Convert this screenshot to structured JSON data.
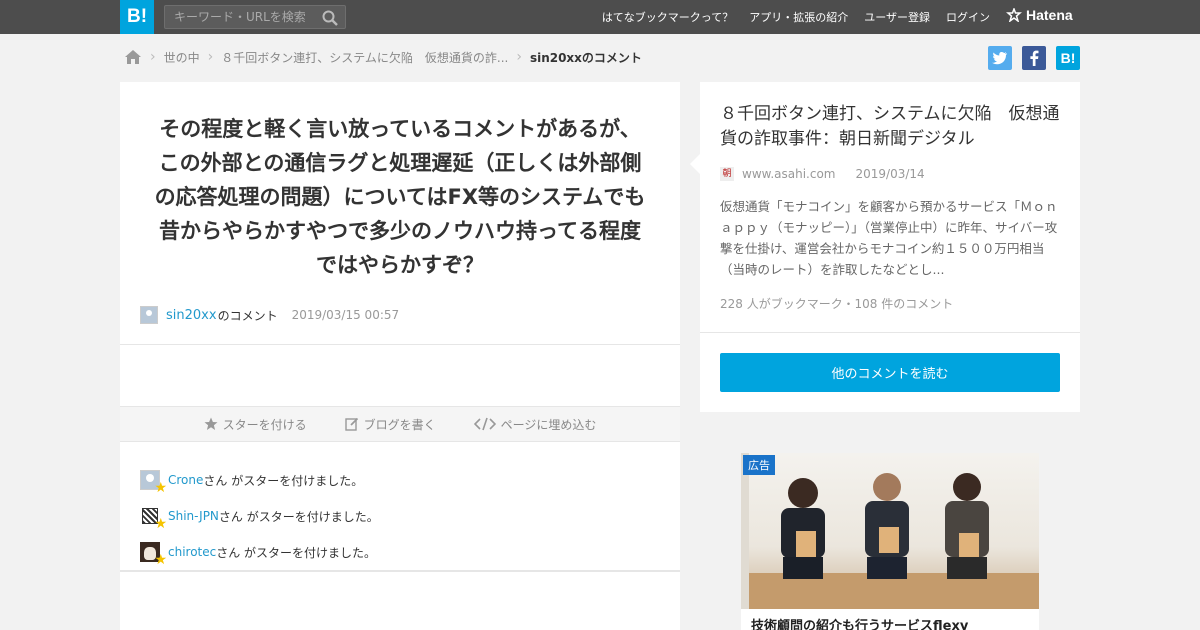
{
  "header": {
    "logo": "B!",
    "search_placeholder": "キーワード・URLを検索",
    "nav": [
      "はてなブックマークって？",
      "アプリ・拡張の紹介",
      "ユーザー登録",
      "ログイン"
    ],
    "brand": "Hatena"
  },
  "breadcrumb": {
    "items": [
      "世の中",
      "８千回ボタン連打、システムに欠陥　仮想通貨の詐..."
    ],
    "current": "sin20xxのコメント"
  },
  "share": {
    "hatena": "B!"
  },
  "comment": {
    "text": "その程度と軽く言い放っているコメントがあるが、この外部との通信ラグと処理遅延（正しくは外部側の応答処理の問題）についてはFX等のシステムでも昔からやらかすやつで多少のノウハウ持ってる程度ではやらかすぞ？",
    "user": "sin20xx",
    "user_suffix": "のコメント",
    "date": "2019/03/15 00:57"
  },
  "actions": {
    "star": "スターを付ける",
    "blog": "ブログを書く",
    "embed": "ページに埋め込む"
  },
  "stars": [
    {
      "user": "Crone",
      "text": "さん がスターを付けました。"
    },
    {
      "user": "Shin-JPN",
      "text": "さん がスターを付けました。"
    },
    {
      "user": "chirotec",
      "text": "さん がスターを付けました。"
    }
  ],
  "article": {
    "title": "８千回ボタン連打、システムに欠陥　仮想通貨の詐取事件：朝日新聞デジタル",
    "favicon": "朝",
    "domain": "www.asahi.com",
    "date": "2019/03/14",
    "description": "仮想通貨「モナコイン」を顧客から預かるサービス「Ｍｏｎａｐｐｙ（モナッピー）」（営業停止中）に昨年、サイバー攻撃を仕掛け、運営会社からモナコイン約１５００万円相当（当時のレート）を詐取したなどとし...",
    "stats": "228 人がブックマーク・108 件のコメント",
    "read_more": "他のコメントを読む"
  },
  "ad": {
    "tag": "広告",
    "title": "技術顧問の紹介も行うサービスflexy"
  }
}
